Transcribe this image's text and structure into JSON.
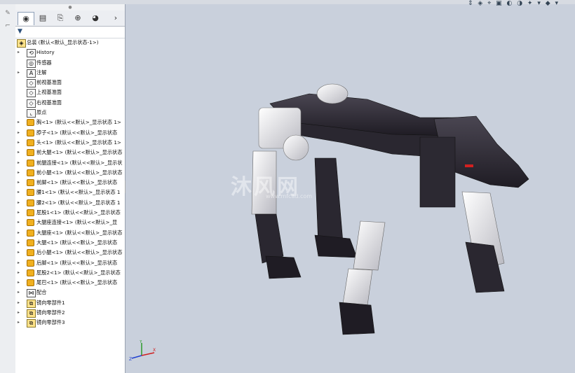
{
  "topstrip_labels": [
    "",
    "",
    "",
    ""
  ],
  "panel": {
    "tabs": [
      {
        "name": "featuremanager-tab",
        "icon": "◉"
      },
      {
        "name": "propertymanager-tab",
        "icon": "▤"
      },
      {
        "name": "configurationmanager-tab",
        "icon": "⎘"
      },
      {
        "name": "dimxpert-tab",
        "icon": "⊕"
      },
      {
        "name": "display-manager-tab",
        "icon": "◕"
      }
    ],
    "more_tabs_icon": "›",
    "filter_icon": "▼"
  },
  "tree": [
    {
      "label": "总装  (默认<默认_显示状态-1>)",
      "icon": "assembly-icon",
      "indent": 0,
      "arrow": ""
    },
    {
      "label": "History",
      "icon": "history-icon",
      "indent": 1,
      "arrow": "▸"
    },
    {
      "label": "传感器",
      "icon": "sensor-icon",
      "indent": 1,
      "arrow": ""
    },
    {
      "label": "注解",
      "icon": "annotation-icon",
      "indent": 1,
      "arrow": "▸"
    },
    {
      "label": "前视基准面",
      "icon": "plane-icon",
      "indent": 1,
      "arrow": ""
    },
    {
      "label": "上视基准面",
      "icon": "plane-icon",
      "indent": 1,
      "arrow": ""
    },
    {
      "label": "右视基准面",
      "icon": "plane-icon",
      "indent": 1,
      "arrow": ""
    },
    {
      "label": "原点",
      "icon": "origin-icon",
      "indent": 1,
      "arrow": ""
    },
    {
      "label": "胸<1> (默认<<默认>_显示状态 1>",
      "icon": "part-icon",
      "indent": 1,
      "arrow": "▸"
    },
    {
      "label": "脖子<1> (默认<<默认>_显示状态",
      "icon": "part-icon",
      "indent": 1,
      "arrow": "▸"
    },
    {
      "label": "头<1> (默认<<默认>_显示状态 1>",
      "icon": "part-icon",
      "indent": 1,
      "arrow": "▸"
    },
    {
      "label": "前大腿<1> (默认<<默认>_显示状态",
      "icon": "part-icon",
      "indent": 1,
      "arrow": "▸"
    },
    {
      "label": "前腿连接<1> (默认<<默认>_显示状",
      "icon": "part-icon",
      "indent": 1,
      "arrow": "▸"
    },
    {
      "label": "前小腿<1> (默认<<默认>_显示状态",
      "icon": "part-icon",
      "indent": 1,
      "arrow": "▸"
    },
    {
      "label": "前脚<1> (默认<<默认>_显示状态",
      "icon": "part-icon",
      "indent": 1,
      "arrow": "▸"
    },
    {
      "label": "腰1<1> (默认<<默认>_显示状态 1",
      "icon": "part-icon",
      "indent": 1,
      "arrow": "▸"
    },
    {
      "label": "腰2<1> (默认<<默认>_显示状态 1",
      "icon": "part-icon",
      "indent": 1,
      "arrow": "▸"
    },
    {
      "label": "屁股1<1> (默认<<默认>_显示状态",
      "icon": "part-icon",
      "indent": 1,
      "arrow": "▸"
    },
    {
      "label": "大腿座连接<1> (默认<<默认>_显",
      "icon": "part-icon",
      "indent": 1,
      "arrow": "▸"
    },
    {
      "label": "大腿座<1> (默认<<默认>_显示状态",
      "icon": "part-icon",
      "indent": 1,
      "arrow": "▸"
    },
    {
      "label": "大腿<1> (默认<<默认>_显示状态",
      "icon": "part-icon",
      "indent": 1,
      "arrow": "▸"
    },
    {
      "label": "后小腿<1> (默认<<默认>_显示状态",
      "icon": "part-icon",
      "indent": 1,
      "arrow": "▸"
    },
    {
      "label": "后脚<1> (默认<<默认>_显示状态",
      "icon": "part-icon",
      "indent": 1,
      "arrow": "▸"
    },
    {
      "label": "屁股2<1> (默认<<默认>_显示状态",
      "icon": "part-icon",
      "indent": 1,
      "arrow": "▸"
    },
    {
      "label": "尾巴<1> (默认<<默认>_显示状态",
      "icon": "part-icon",
      "indent": 1,
      "arrow": "▸"
    },
    {
      "label": "配合",
      "icon": "mates-icon",
      "indent": 1,
      "arrow": "▸"
    },
    {
      "label": "镜向零部件1",
      "icon": "mirror-component-icon",
      "indent": 1,
      "arrow": "▸"
    },
    {
      "label": "镜向零部件2",
      "icon": "mirror-component-icon",
      "indent": 1,
      "arrow": "▸"
    },
    {
      "label": "镜向零部件3",
      "icon": "mirror-component-icon",
      "indent": 1,
      "arrow": "▸"
    }
  ],
  "viewport": {
    "watermark": "沐风网",
    "watermark_sub": "www.mfcad.com",
    "triad_labels": {
      "x": "X",
      "y": "Y",
      "z": "Z"
    },
    "heads_up_icons": "⇕ ◈ ⌖ ▣ ◐ ◑ ✦ ▾ ◆ ▾"
  },
  "colors": {
    "background": "#c9d0dc",
    "dark_part": "#2f2c35",
    "light_part": "#e8e8ea",
    "accent_red": "#d22020"
  }
}
